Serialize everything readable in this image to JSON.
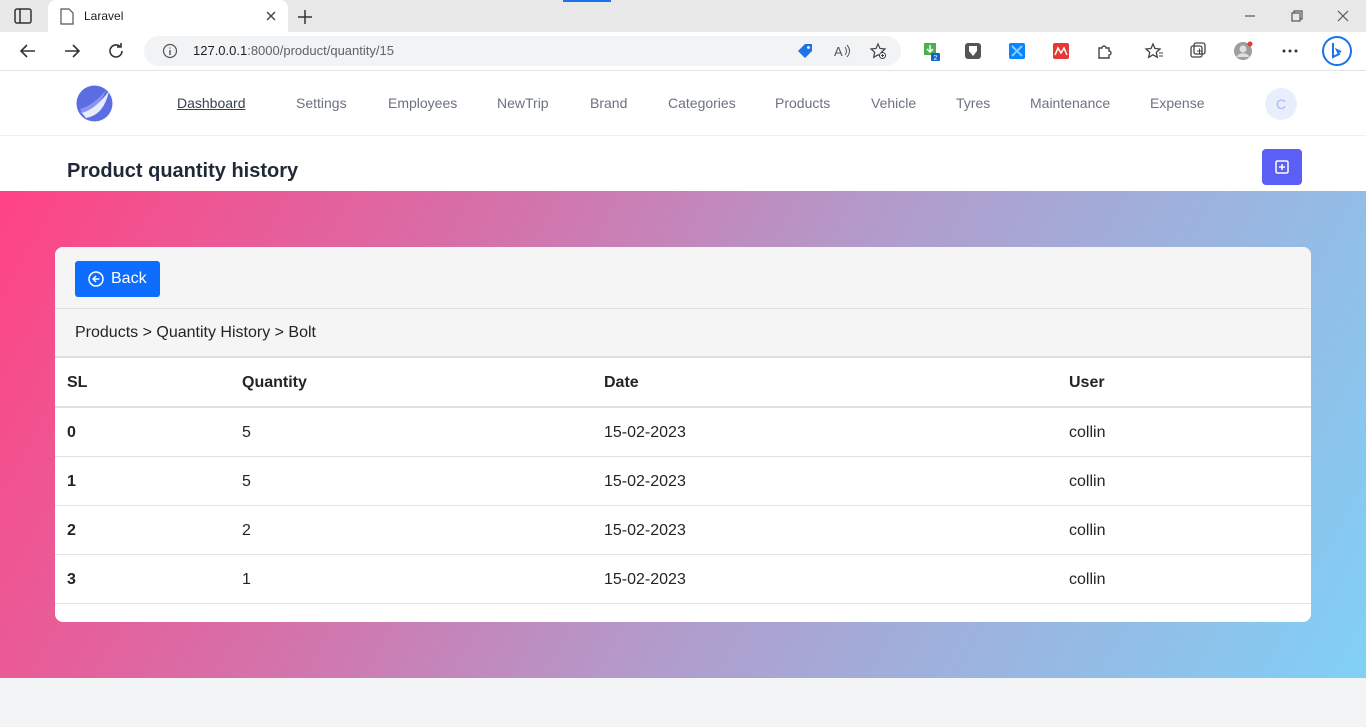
{
  "browser": {
    "tab_title": "Laravel",
    "url_host": "127.0.0.1",
    "url_rest": ":8000/product/quantity/15",
    "extension_badge": "2"
  },
  "nav": {
    "items": [
      {
        "label": "Dashboard",
        "active": true
      },
      {
        "label": "Settings"
      },
      {
        "label": "Employees"
      },
      {
        "label": "NewTrip"
      },
      {
        "label": "Brand"
      },
      {
        "label": "Categories"
      },
      {
        "label": "Products"
      },
      {
        "label": "Vehicle"
      },
      {
        "label": "Tyres"
      },
      {
        "label": "Maintenance"
      },
      {
        "label": "Expense"
      }
    ],
    "user_initial": "C"
  },
  "page": {
    "title": "Product quantity history",
    "back_label": "Back",
    "breadcrumb": "Products > Quantity History > Bolt"
  },
  "table": {
    "headers": [
      "SL",
      "Quantity",
      "Date",
      "User"
    ],
    "rows": [
      [
        "0",
        "5",
        "15-02-2023",
        "collin"
      ],
      [
        "1",
        "5",
        "15-02-2023",
        "collin"
      ],
      [
        "2",
        "2",
        "15-02-2023",
        "collin"
      ],
      [
        "3",
        "1",
        "15-02-2023",
        "collin"
      ]
    ]
  }
}
